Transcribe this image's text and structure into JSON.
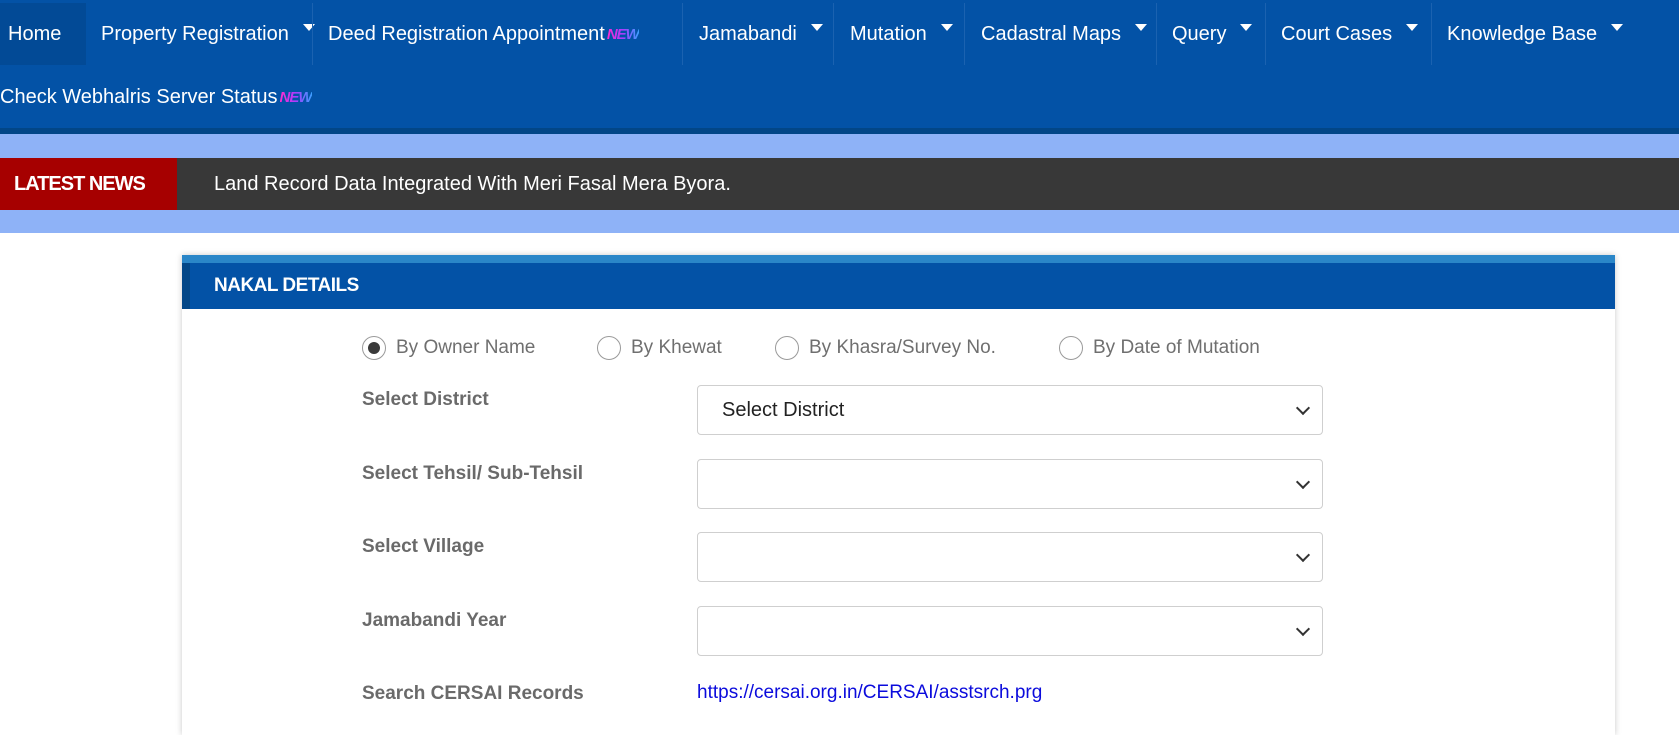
{
  "nav": {
    "items": [
      {
        "label": "Home"
      },
      {
        "label": "Property Registration"
      },
      {
        "label": "Deed Registration Appointment",
        "badge": "NEW"
      },
      {
        "label": "Jamabandi"
      },
      {
        "label": "Mutation"
      },
      {
        "label": "Cadastral Maps"
      },
      {
        "label": "Query"
      },
      {
        "label": "Court Cases"
      },
      {
        "label": "Knowledge Base"
      }
    ],
    "second_row": {
      "label": "Check Webhalris Server Status",
      "badge": "NEW"
    }
  },
  "news": {
    "label": "LATEST NEWS",
    "text": "Land Record Data Integrated With Meri Fasal Mera Byora."
  },
  "panel": {
    "title": "NAKAL DETAILS",
    "radios": [
      {
        "label": "By Owner Name",
        "checked": true
      },
      {
        "label": "By Khewat",
        "checked": false
      },
      {
        "label": "By Khasra/Survey No.",
        "checked": false
      },
      {
        "label": "By Date of Mutation",
        "checked": false
      }
    ],
    "fields": [
      {
        "label": "Select District",
        "value": "Select District"
      },
      {
        "label": "Select Tehsil/ Sub-Tehsil",
        "value": ""
      },
      {
        "label": "Select Village",
        "value": ""
      },
      {
        "label": "Jamabandi Year",
        "value": ""
      }
    ],
    "cersai": {
      "label": "Search CERSAI Records",
      "link": "https://cersai.org.in/CERSAI/asstsrch.prg"
    }
  },
  "colors": {
    "nav_blue": "#0352a6",
    "news_red": "#a60000",
    "news_dark": "#383838",
    "band_light_blue": "#8eb2f7",
    "link_blue": "#0b0bdc"
  }
}
